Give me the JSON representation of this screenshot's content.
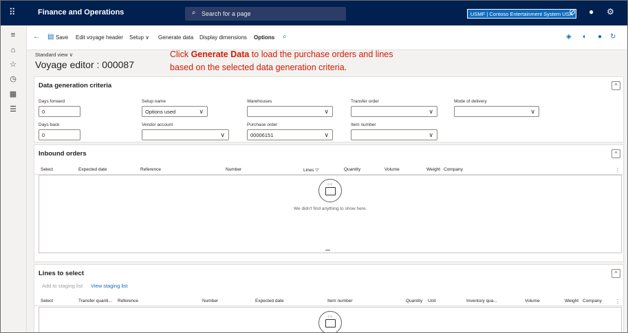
{
  "topbar": {
    "app_title": "Finance and Operations",
    "search_placeholder": "Search for a page",
    "company": "USMF | Contoso Entertainment System USA"
  },
  "actionbar": {
    "save": "Save",
    "edit_header": "Edit voyage header",
    "setup": "Setup",
    "generate": "Generate data",
    "display_dimensions": "Display dimensions",
    "options": "Options"
  },
  "page": {
    "standard_view": "Standard view",
    "title": "Voyage editor : 000087"
  },
  "callout": {
    "prefix": "Click ",
    "emphasis": "Generate Data",
    "suffix": " to load the purchase orders and lines based on the selected data generation criteria."
  },
  "criteria": {
    "title": "Data generation criteria",
    "days_forward_label": "Days forward",
    "days_forward_value": "0",
    "days_back_label": "Days back",
    "days_back_value": "0",
    "setup_name_label": "Setup name",
    "setup_name_value": "Options used",
    "vendor_account_label": "Vendor account",
    "vendor_account_value": "",
    "warehouses_label": "Warehouses",
    "warehouses_value": "",
    "purchase_order_label": "Purchase order",
    "purchase_order_value": "00006151",
    "transfer_order_label": "Transfer order",
    "transfer_order_value": "",
    "item_number_label": "Item number",
    "item_number_value": "",
    "mode_of_delivery_label": "Mode of delivery",
    "mode_of_delivery_value": ""
  },
  "inbound": {
    "title": "Inbound orders",
    "columns": [
      "Select",
      "Expected date",
      "Reference",
      "Number",
      "Lines",
      "Quantity",
      "Volume",
      "Weight",
      "Company"
    ],
    "empty_text": "We didn't find anything to show here."
  },
  "lines": {
    "title": "Lines to select",
    "add_to_staging": "Add to staging list",
    "view_staging": "View staging list",
    "columns": [
      "Select",
      "Transfer quanti...",
      "Reference",
      "Number",
      "Expected date",
      "Item number",
      "Quantity",
      "Unit",
      "Inventory qua...",
      "Volume",
      "Weight",
      "Company"
    ]
  },
  "colors": {
    "topbar": "#002050",
    "accent": "#0f6cbd",
    "callout": "#d11a00"
  }
}
